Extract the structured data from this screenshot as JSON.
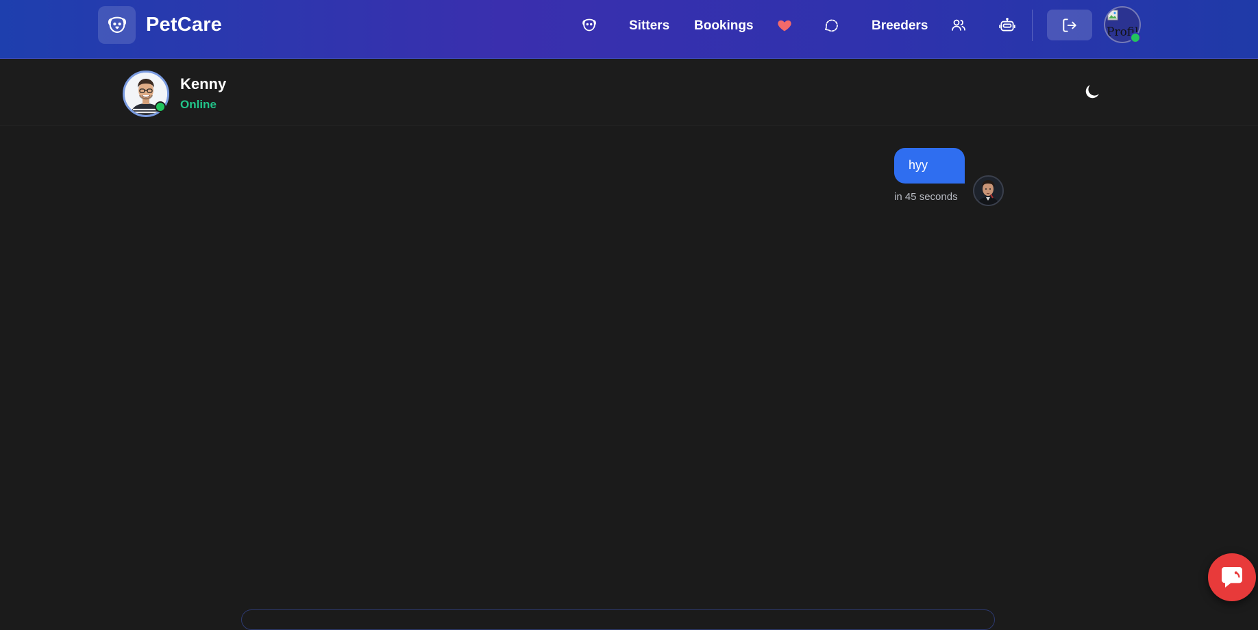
{
  "app": {
    "brand": "PetCare",
    "logo_icon": "dog-face-icon"
  },
  "nav": {
    "pets_icon": "dog-face-icon",
    "sitters_label": "Sitters",
    "bookings_label": "Bookings",
    "favorites_icon": "heart-icon",
    "chat_icon": "chat-bubble-icon",
    "breeders_label": "Breeders",
    "users_icon": "users-icon",
    "bot_icon": "robot-icon",
    "logout_icon": "logout-icon",
    "profile_alt": "Profil"
  },
  "colors": {
    "accent": "#2f6ef0",
    "online": "#22c55e",
    "online_text": "#22c58a",
    "fab": "#e83a3a"
  },
  "chat": {
    "contact_name": "Kenny",
    "contact_status": "Online",
    "theme_icon": "moon-icon",
    "messages": [
      {
        "text": "hyy",
        "time": "in 45 seconds",
        "from": "me"
      }
    ]
  },
  "help": {
    "icon": "support-chat-icon"
  }
}
